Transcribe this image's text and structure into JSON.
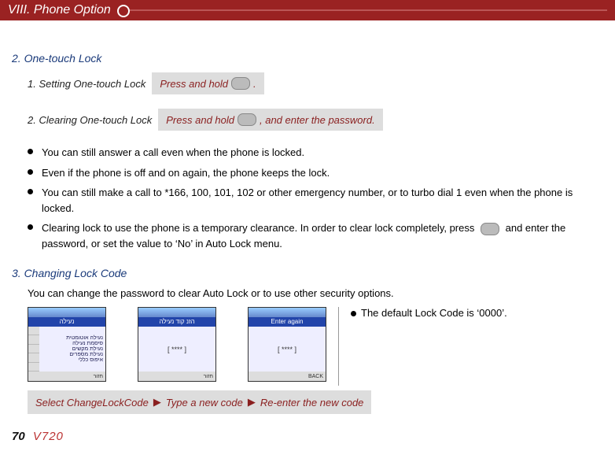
{
  "header": {
    "title": "VIII. Phone Option"
  },
  "sections": {
    "onetouch": {
      "title": "2. One-touch Lock",
      "setting": {
        "label": "1. Setting One-touch Lock",
        "instruction_pre": "Press and hold ",
        "instruction_post": "."
      },
      "clearing": {
        "label": "2. Clearing One-touch Lock",
        "instruction_pre": "Press and hold ",
        "instruction_post": ", and enter the password."
      },
      "bullets": [
        "You can still answer a call even when the phone is locked.",
        "Even if the phone is off and on again, the phone keeps the lock.",
        "You can still make a call to *166, 100, 101, 102 or other emergency number, or to turbo dial 1 even when the phone is locked."
      ],
      "bullet4_pre": "Clearing lock to use the phone is a temporary clearance. In order to clear lock completely, press ",
      "bullet4_post": " and enter the password, or set the value to ‘No’ in Auto Lock menu."
    },
    "changing": {
      "title": "3. Changing Lock Code",
      "desc": "You can change the password to clear Auto Lock or to use other security options.",
      "screens": {
        "head2": "הזנ קוד נעילה",
        "head3": "Enter again",
        "mask": "[ **** ]",
        "foot_left": "חזור",
        "foot_right": "BACK"
      },
      "note": "The default Lock Code is ‘0000’.",
      "steps": {
        "s1": "Select ChangeLockCode",
        "s2": "Type a new code",
        "s3": "Re-enter the new code"
      }
    }
  },
  "footer": {
    "page": "70",
    "model": "V720"
  }
}
